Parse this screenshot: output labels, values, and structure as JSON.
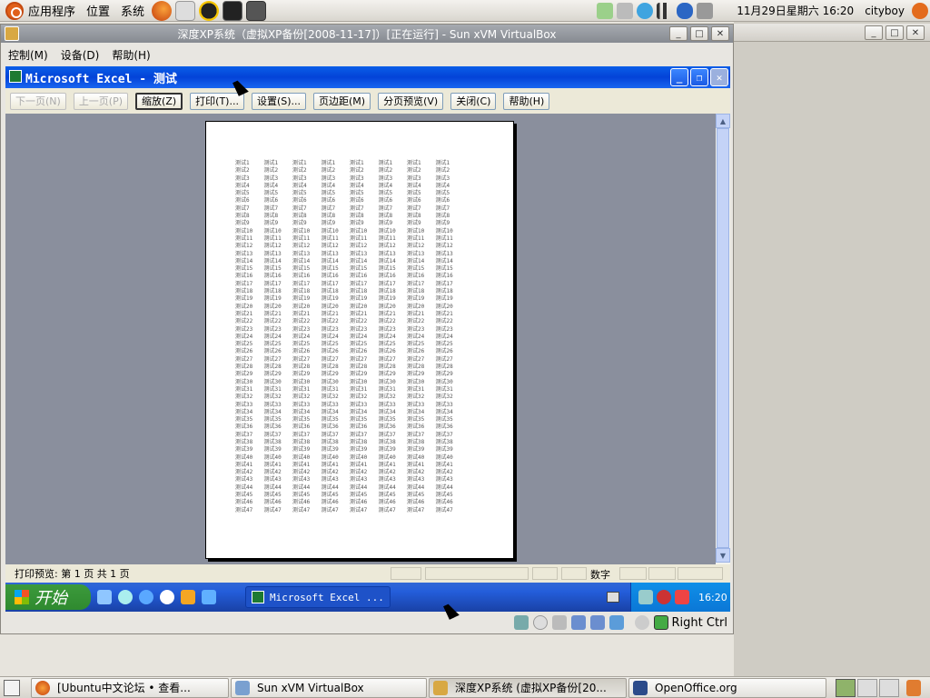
{
  "top_panel": {
    "menu_apps": "应用程序",
    "menu_places": "位置",
    "menu_system": "系统",
    "datetime": "11月29日星期六 16:20",
    "user": "cityboy"
  },
  "vbox": {
    "title": "深度XP系统（虚拟XP备份[2008-11-17]）[正在运行] - Sun xVM VirtualBox",
    "menu": [
      "控制(M)",
      "设备(D)",
      "帮助(H)"
    ],
    "status_right": "Right Ctrl"
  },
  "excel": {
    "title": "Microsoft Excel - 测试",
    "toolbar": [
      {
        "label": "下一页(N)",
        "state": "disabled"
      },
      {
        "label": "上一页(P)",
        "state": "disabled"
      },
      {
        "label": "缩放(Z)",
        "state": "active"
      },
      {
        "label": "打印(T)...",
        "state": "normal"
      },
      {
        "label": "设置(S)...",
        "state": "normal"
      },
      {
        "label": "页边距(M)",
        "state": "normal"
      },
      {
        "label": "分页预览(V)",
        "state": "normal"
      },
      {
        "label": "关闭(C)",
        "state": "normal"
      },
      {
        "label": "帮助(H)",
        "state": "normal"
      }
    ],
    "status_left": "打印预览: 第 1 页 共 1 页",
    "status_mode": "数字",
    "sheet_prefix": "测试",
    "sheet_rows": 47,
    "sheet_cols": 8
  },
  "xp_taskbar": {
    "start_label": "开始",
    "excel_button": "Microsoft Excel ...",
    "clock": "16:20"
  },
  "bottom_panel": {
    "tasks": [
      {
        "label": "[Ubuntu中文论坛 • 查看...",
        "active": false
      },
      {
        "label": "Sun xVM VirtualBox",
        "active": false
      },
      {
        "label": "深度XP系统 (虚拟XP备份[20...",
        "active": true
      },
      {
        "label": "OpenOffice.org",
        "active": false
      }
    ]
  },
  "colors": {
    "xp_blue": "#0a5ee8",
    "preview_bg": "#8a8f9d",
    "ubuntu_orange": "#e0601a"
  }
}
